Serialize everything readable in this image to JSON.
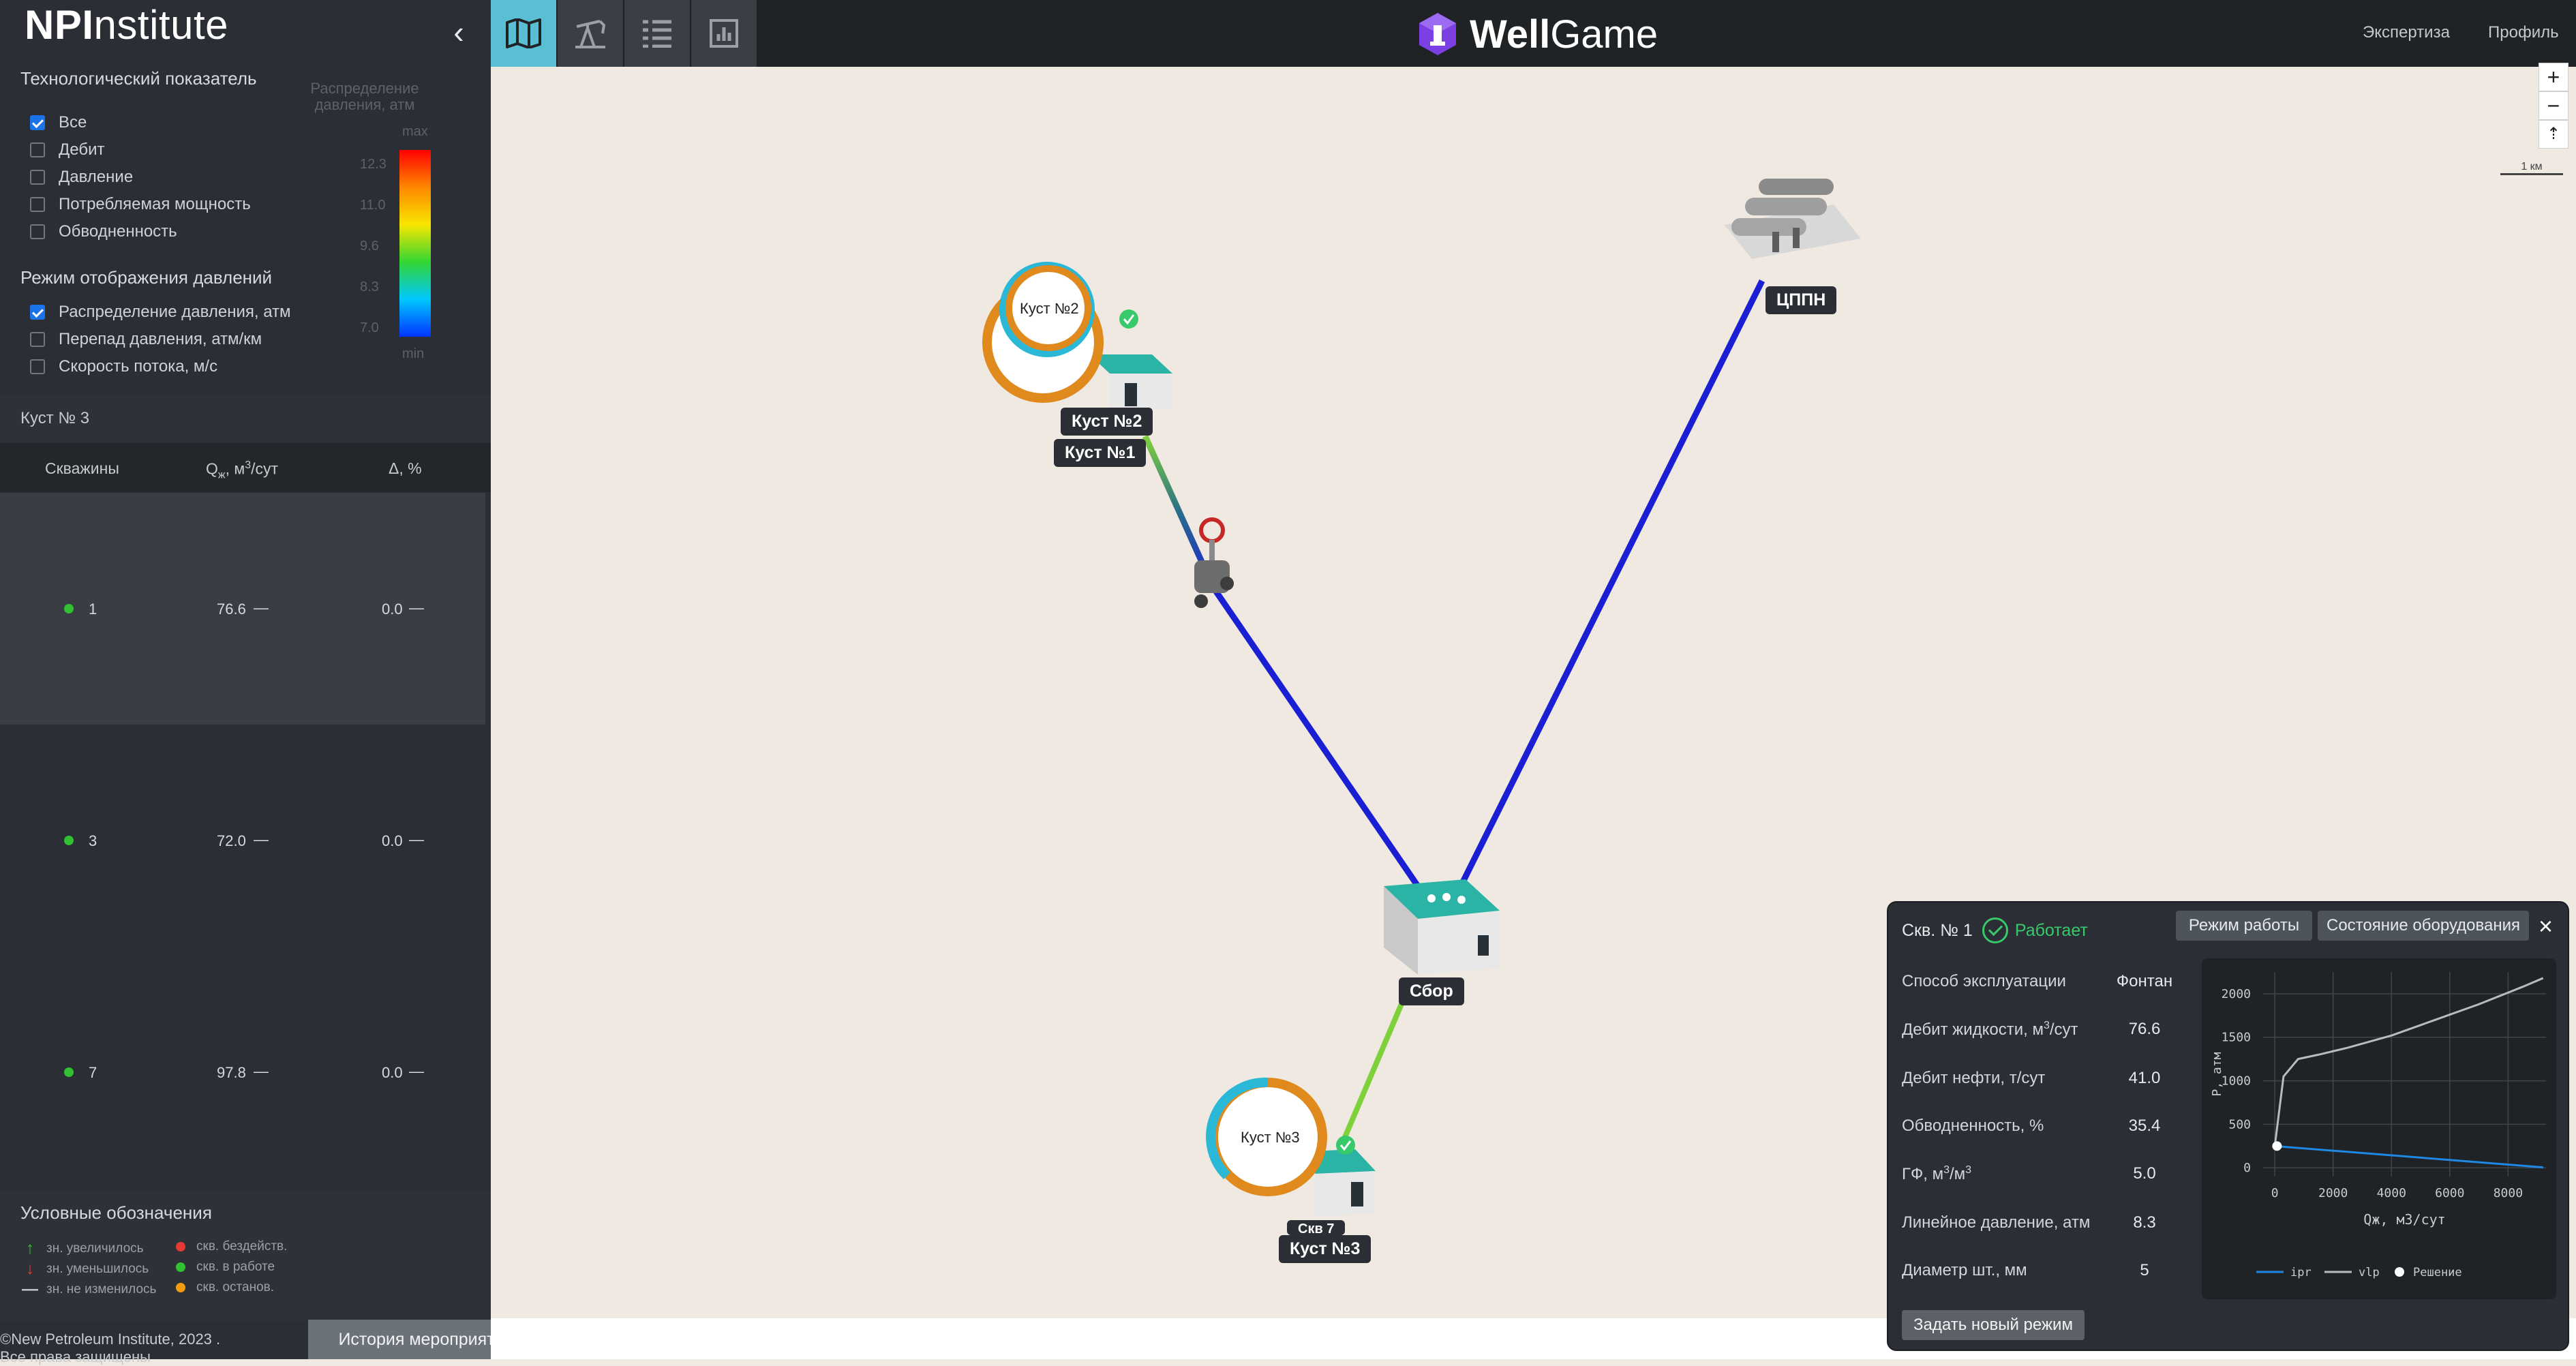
{
  "brand": {
    "bold": "NPI",
    "light": "nstitute"
  },
  "sidebar": {
    "collapse_icon": "chevron-left-icon",
    "tech_section_title": "Технологический показатель",
    "tech_options": [
      {
        "label": "Все",
        "checked": true
      },
      {
        "label": "Дебит",
        "checked": false
      },
      {
        "label": "Давление",
        "checked": false
      },
      {
        "label": "Потребляемая мощность",
        "checked": false
      },
      {
        "label": "Обводненность",
        "checked": false
      }
    ],
    "pressure_mode_title": "Режим отображения давлений",
    "pressure_options": [
      {
        "label": "Распределение давления, атм",
        "checked": true
      },
      {
        "label": "Перепад давления, атм/км",
        "checked": false
      },
      {
        "label": "Скорость потока, м/с",
        "checked": false
      }
    ],
    "scale": {
      "title": "Распределение давления, атм",
      "max_label": "max",
      "min_label": "min",
      "ticks": [
        "12.3",
        "11.0",
        "9.6",
        "8.3",
        "7.0"
      ]
    },
    "kust_title": "Куст № 3",
    "table": {
      "col_wells": "Скважины",
      "col_q_prefix": "Q",
      "col_q_sub": "ж",
      "col_q_suffix": ", м",
      "col_q_sup": "3",
      "col_q_tail": "/сут",
      "col_delta": "Δ, %",
      "rows": [
        {
          "well": "1",
          "q": "76.6",
          "delta": "0.0",
          "trend": "—",
          "status": "в работе"
        },
        {
          "well": "3",
          "q": "72.0",
          "delta": "0.0",
          "trend": "—",
          "status": "в работе"
        },
        {
          "well": "7",
          "q": "97.8",
          "delta": "0.0",
          "trend": "—",
          "status": "в работе"
        }
      ]
    },
    "legend": {
      "title": "Условные обозначения",
      "items_left": [
        "зн. увеличилось",
        "зн. уменьшилось",
        "зн. не изменилось"
      ],
      "items_right": [
        "скв. бездейств.",
        "скв. в работе",
        "скв. останов."
      ],
      "colors": {
        "idle": "#e53935",
        "working": "#32c132",
        "stopped": "#f39c12",
        "up": "#32c132",
        "down": "#e53935"
      }
    },
    "copyright_line1": "©New Petroleum Institute, 2023 .",
    "copyright_line2": "Все права защищены",
    "history_button": "История мероприятий"
  },
  "topbar": {
    "tabs": [
      {
        "name": "map-tab",
        "icon": "map-icon",
        "active": true
      },
      {
        "name": "pump-tab",
        "icon": "pumpjack-icon",
        "active": false
      },
      {
        "name": "list-tab",
        "icon": "list-icon",
        "active": false
      },
      {
        "name": "chart-tab",
        "icon": "bar-chart-icon",
        "active": false
      }
    ],
    "logo_bold": "Well",
    "logo_light": "Game",
    "links": [
      "Экспертиза",
      "Профиль"
    ]
  },
  "map": {
    "zoom_in": "+",
    "zoom_out": "−",
    "compass": "⇡",
    "scale_label": "1 км",
    "nodes": {
      "kust2_circle": "Куст №2",
      "kust2_tag": "Куст №2",
      "kust1_tag": "Куст №1",
      "kust3_circle": "Куст №3",
      "kust3_tag": "Куст №3",
      "kust3_hidden_tag": "Скв 7",
      "sbor_tag": "Сбор",
      "cppn_tag": "ЦППН"
    },
    "colors": {
      "pipe_main": "#1a1fd4",
      "pipe_green": "#7fd13b",
      "ring_orange": "#e0891c",
      "ring_cyan": "#2ab8d6"
    }
  },
  "card": {
    "title": "Скв. № 1",
    "status": "Работает",
    "btn_mode": "Режим работы",
    "btn_equipment": "Состояние оборудования",
    "close": "×",
    "params": [
      {
        "label": "Способ эксплуатации",
        "value": "Фонтан"
      },
      {
        "label": "Дебит жидкости, м",
        "sup": "3",
        "tail": "/сут",
        "value": "76.6"
      },
      {
        "label": "Дебит нефти, т/сут",
        "value": "41.0"
      },
      {
        "label": "Обводненность, %",
        "value": "35.4"
      },
      {
        "label": "ГФ, м",
        "sup": "3",
        "tail": "/м",
        "sup2": "3",
        "value": "5.0"
      },
      {
        "label": "Линейное давление, атм",
        "value": "8.3"
      },
      {
        "label": "Диаметр шт., мм",
        "value": "5"
      }
    ],
    "action_button": "Задать новый режим"
  },
  "chart_data": {
    "type": "line",
    "xlabel": "Qж, м3/сут",
    "ylabel": "P, атм",
    "xlim": [
      -400,
      9300
    ],
    "ylim": [
      -100,
      2250
    ],
    "x_ticks": [
      0,
      2000,
      4000,
      6000,
      8000
    ],
    "y_ticks": [
      0,
      500,
      1000,
      1500,
      2000
    ],
    "grid": true,
    "legend_position": "bottom",
    "series": [
      {
        "name": "ipr",
        "color": "#1e88e5",
        "x": [
          0,
          9200
        ],
        "y": [
          250,
          5
        ]
      },
      {
        "name": "vlp",
        "color": "#b8bcc0",
        "x": [
          0,
          300,
          800,
          1500,
          2500,
          4000,
          5500,
          7000,
          8500,
          9200
        ],
        "y": [
          250,
          1050,
          1250,
          1300,
          1380,
          1520,
          1700,
          1880,
          2080,
          2180
        ]
      }
    ],
    "solution": {
      "name": "Решение",
      "x": 76.6,
      "y": 250
    }
  }
}
